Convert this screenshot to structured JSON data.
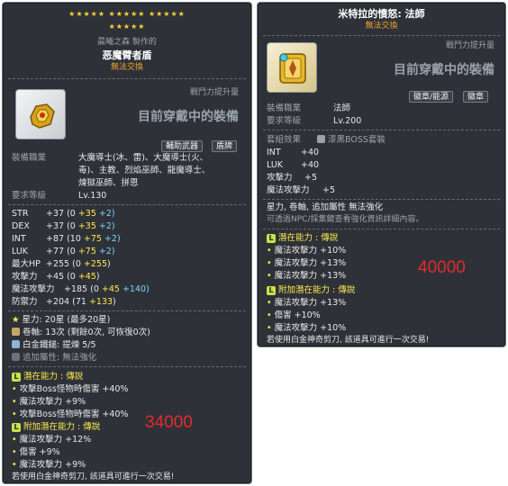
{
  "left": {
    "star_rows": [
      "★★★★★  ★★★★★  ★★★★★",
      "★★★★★"
    ],
    "maker": "晨曦之森 製作的",
    "item_name": "恶魔臂者盾",
    "trade_note": "無法交換",
    "power_up_label": "戰鬥力提升量",
    "equipped_text": "目前穿戴中的裝備",
    "tags": [
      "輔助武器",
      "盾牌"
    ],
    "job_label": "裝備職業",
    "jobs_lines": [
      "大魔導士(冰、雷)、大魔導士(火、",
      "毒)、主教、烈焰巫師、龍魔導士、",
      "煉獄巫師、拼恩"
    ],
    "req_label": "要求等級",
    "req_value": "Lv.130",
    "stats": [
      {
        "name": "STR",
        "base": "+37 (0 ",
        "add": "+35",
        "extra": " +2)"
      },
      {
        "name": "DEX",
        "base": "+37 (0 ",
        "add": "+35",
        "extra": " +2)"
      },
      {
        "name": "INT",
        "base": "+87 (10 ",
        "add": "+75",
        "extra": " +2)"
      },
      {
        "name": "LUK",
        "base": "+77 (0 ",
        "add": "+75",
        "extra": " +2)"
      },
      {
        "name": "最大HP",
        "base": "+255 (0 ",
        "add": "+255",
        "extra": ")"
      },
      {
        "name": "攻擊力",
        "base": "+45 (0 ",
        "add": "+45",
        "extra": ")"
      },
      {
        "name": "魔法攻擊力",
        "base": "+185 (0 ",
        "add": "+45",
        "extra": " +140)"
      },
      {
        "name": "防禦力",
        "base": "+204 (71 ",
        "add": "+133",
        "extra": ")"
      }
    ],
    "star_force": "星力: 20星 (最多20星)",
    "scroll": "卷軸: 13次 (剩餘0次, 可恢復0次)",
    "platinum": "白金鐵鎚: 提煉 5/5",
    "extra_attr": "追加屬性: 無法強化",
    "potential_title": "潛在能力 : 傳說",
    "potential_lines": [
      "攻擊Boss怪物時傷害 +40%",
      "魔法攻擊力 +9%",
      "攻擊Boss怪物時傷害 +40%"
    ],
    "bonus_title": "附加潛在能力 : 傳說",
    "bonus_lines": [
      "魔法攻擊力 +12%",
      "傷害 +9%",
      "魔法攻擊力 +9%"
    ],
    "footer": "若使用白金神奇剪刀, 該道具可進行一次交易!",
    "price": "34000"
  },
  "right": {
    "item_name": "米特拉的憤怒: 法師",
    "trade_note": "無法交換",
    "power_up_label": "戰鬥力提升量",
    "equipped_text": "目前穿戴中的裝備",
    "tags": [
      "徽章/能源",
      "徽章"
    ],
    "job_label": "裝備職業",
    "job_value": "法師",
    "req_label": "要求等級",
    "req_value": "Lv.200",
    "set_label": "套組效果",
    "set_value": "漆黑BOSS套裝",
    "stats": [
      {
        "name": "INT",
        "value": "+40"
      },
      {
        "name": "LUK",
        "value": "+40"
      },
      {
        "name": "攻擊力",
        "value": "+5"
      },
      {
        "name": "魔法攻擊力",
        "value": "+5"
      }
    ],
    "note1": "星力, 卷軸, 追加屬性 無法強化",
    "note2": "可透過NPC/採集鍵查看強化資訊詳細內容。",
    "potential_title": "潛在能力 : 傳說",
    "potential_lines": [
      "魔法攻擊力 +10%",
      "魔法攻擊力 +13%",
      "魔法攻擊力 +13%"
    ],
    "bonus_title": "附加潛在能力 : 傳說",
    "bonus_lines": [
      "魔法攻擊力 +13%",
      "傷害 +10%",
      "魔法攻擊力 +10%"
    ],
    "footer": "若使用白金神奇剪刀, 該道具可進行一次交易!",
    "price": "40000"
  }
}
